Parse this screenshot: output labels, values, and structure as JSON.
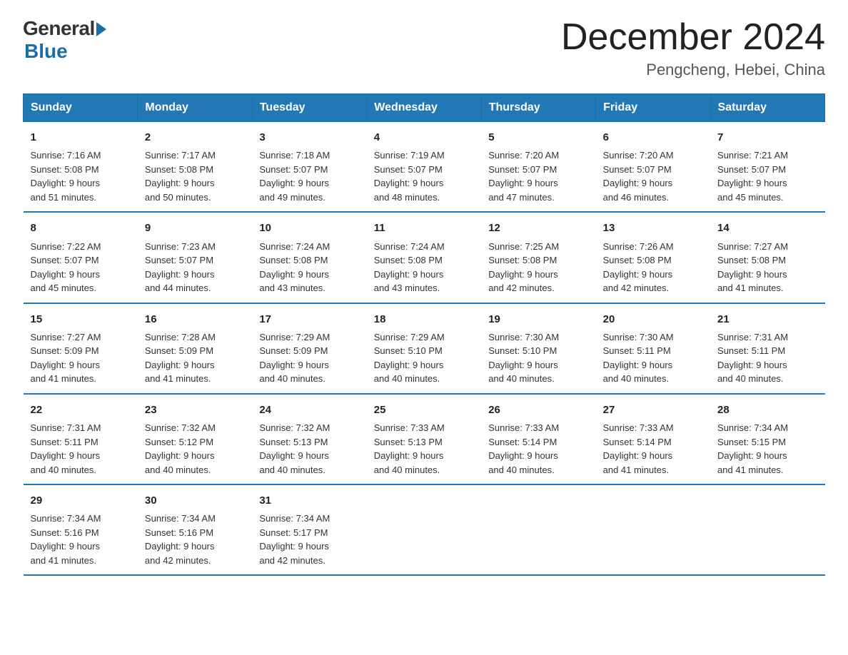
{
  "header": {
    "logo_general": "General",
    "logo_blue": "Blue",
    "month_title": "December 2024",
    "location": "Pengcheng, Hebei, China"
  },
  "weekdays": [
    "Sunday",
    "Monday",
    "Tuesday",
    "Wednesday",
    "Thursday",
    "Friday",
    "Saturday"
  ],
  "weeks": [
    [
      {
        "day": "1",
        "sunrise": "7:16 AM",
        "sunset": "5:08 PM",
        "daylight": "9 hours and 51 minutes."
      },
      {
        "day": "2",
        "sunrise": "7:17 AM",
        "sunset": "5:08 PM",
        "daylight": "9 hours and 50 minutes."
      },
      {
        "day": "3",
        "sunrise": "7:18 AM",
        "sunset": "5:07 PM",
        "daylight": "9 hours and 49 minutes."
      },
      {
        "day": "4",
        "sunrise": "7:19 AM",
        "sunset": "5:07 PM",
        "daylight": "9 hours and 48 minutes."
      },
      {
        "day": "5",
        "sunrise": "7:20 AM",
        "sunset": "5:07 PM",
        "daylight": "9 hours and 47 minutes."
      },
      {
        "day": "6",
        "sunrise": "7:20 AM",
        "sunset": "5:07 PM",
        "daylight": "9 hours and 46 minutes."
      },
      {
        "day": "7",
        "sunrise": "7:21 AM",
        "sunset": "5:07 PM",
        "daylight": "9 hours and 45 minutes."
      }
    ],
    [
      {
        "day": "8",
        "sunrise": "7:22 AM",
        "sunset": "5:07 PM",
        "daylight": "9 hours and 45 minutes."
      },
      {
        "day": "9",
        "sunrise": "7:23 AM",
        "sunset": "5:07 PM",
        "daylight": "9 hours and 44 minutes."
      },
      {
        "day": "10",
        "sunrise": "7:24 AM",
        "sunset": "5:08 PM",
        "daylight": "9 hours and 43 minutes."
      },
      {
        "day": "11",
        "sunrise": "7:24 AM",
        "sunset": "5:08 PM",
        "daylight": "9 hours and 43 minutes."
      },
      {
        "day": "12",
        "sunrise": "7:25 AM",
        "sunset": "5:08 PM",
        "daylight": "9 hours and 42 minutes."
      },
      {
        "day": "13",
        "sunrise": "7:26 AM",
        "sunset": "5:08 PM",
        "daylight": "9 hours and 42 minutes."
      },
      {
        "day": "14",
        "sunrise": "7:27 AM",
        "sunset": "5:08 PM",
        "daylight": "9 hours and 41 minutes."
      }
    ],
    [
      {
        "day": "15",
        "sunrise": "7:27 AM",
        "sunset": "5:09 PM",
        "daylight": "9 hours and 41 minutes."
      },
      {
        "day": "16",
        "sunrise": "7:28 AM",
        "sunset": "5:09 PM",
        "daylight": "9 hours and 41 minutes."
      },
      {
        "day": "17",
        "sunrise": "7:29 AM",
        "sunset": "5:09 PM",
        "daylight": "9 hours and 40 minutes."
      },
      {
        "day": "18",
        "sunrise": "7:29 AM",
        "sunset": "5:10 PM",
        "daylight": "9 hours and 40 minutes."
      },
      {
        "day": "19",
        "sunrise": "7:30 AM",
        "sunset": "5:10 PM",
        "daylight": "9 hours and 40 minutes."
      },
      {
        "day": "20",
        "sunrise": "7:30 AM",
        "sunset": "5:11 PM",
        "daylight": "9 hours and 40 minutes."
      },
      {
        "day": "21",
        "sunrise": "7:31 AM",
        "sunset": "5:11 PM",
        "daylight": "9 hours and 40 minutes."
      }
    ],
    [
      {
        "day": "22",
        "sunrise": "7:31 AM",
        "sunset": "5:11 PM",
        "daylight": "9 hours and 40 minutes."
      },
      {
        "day": "23",
        "sunrise": "7:32 AM",
        "sunset": "5:12 PM",
        "daylight": "9 hours and 40 minutes."
      },
      {
        "day": "24",
        "sunrise": "7:32 AM",
        "sunset": "5:13 PM",
        "daylight": "9 hours and 40 minutes."
      },
      {
        "day": "25",
        "sunrise": "7:33 AM",
        "sunset": "5:13 PM",
        "daylight": "9 hours and 40 minutes."
      },
      {
        "day": "26",
        "sunrise": "7:33 AM",
        "sunset": "5:14 PM",
        "daylight": "9 hours and 40 minutes."
      },
      {
        "day": "27",
        "sunrise": "7:33 AM",
        "sunset": "5:14 PM",
        "daylight": "9 hours and 41 minutes."
      },
      {
        "day": "28",
        "sunrise": "7:34 AM",
        "sunset": "5:15 PM",
        "daylight": "9 hours and 41 minutes."
      }
    ],
    [
      {
        "day": "29",
        "sunrise": "7:34 AM",
        "sunset": "5:16 PM",
        "daylight": "9 hours and 41 minutes."
      },
      {
        "day": "30",
        "sunrise": "7:34 AM",
        "sunset": "5:16 PM",
        "daylight": "9 hours and 42 minutes."
      },
      {
        "day": "31",
        "sunrise": "7:34 AM",
        "sunset": "5:17 PM",
        "daylight": "9 hours and 42 minutes."
      },
      {
        "day": "",
        "sunrise": "",
        "sunset": "",
        "daylight": ""
      },
      {
        "day": "",
        "sunrise": "",
        "sunset": "",
        "daylight": ""
      },
      {
        "day": "",
        "sunrise": "",
        "sunset": "",
        "daylight": ""
      },
      {
        "day": "",
        "sunrise": "",
        "sunset": "",
        "daylight": ""
      }
    ]
  ],
  "labels": {
    "sunrise": "Sunrise:",
    "sunset": "Sunset:",
    "daylight": "Daylight:"
  }
}
